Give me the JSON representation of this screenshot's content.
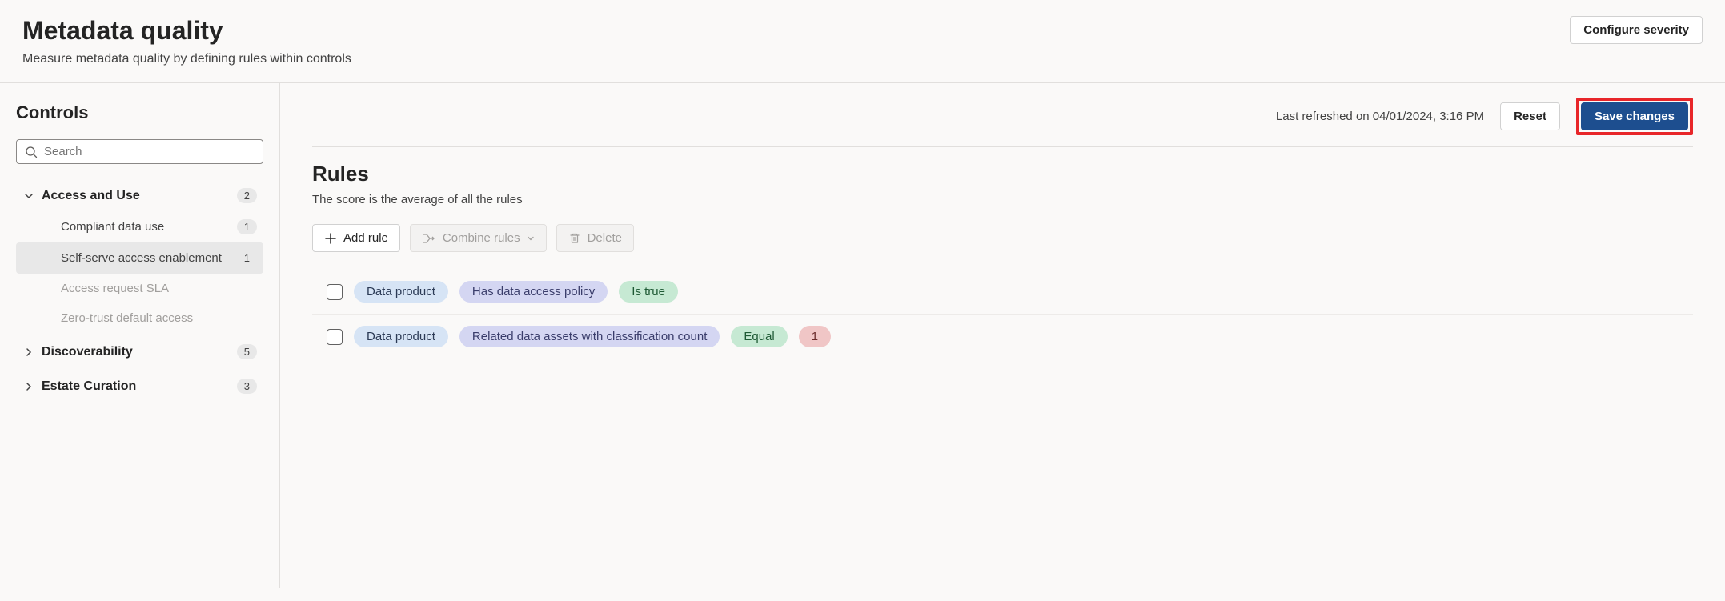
{
  "header": {
    "title": "Metadata quality",
    "subtitle": "Measure metadata quality by defining rules within controls",
    "configure_severity": "Configure severity"
  },
  "sidebar": {
    "title": "Controls",
    "search_placeholder": "Search",
    "groups": [
      {
        "label": "Access and Use",
        "count": "2",
        "expanded": true,
        "items": [
          {
            "label": "Compliant data use",
            "count": "1",
            "selected": false,
            "disabled": false
          },
          {
            "label": "Self-serve access enablement",
            "count": "1",
            "selected": true,
            "disabled": false
          },
          {
            "label": "Access request SLA",
            "count": "",
            "selected": false,
            "disabled": true
          },
          {
            "label": "Zero-trust default access",
            "count": "",
            "selected": false,
            "disabled": true
          }
        ]
      },
      {
        "label": "Discoverability",
        "count": "5",
        "expanded": false,
        "items": []
      },
      {
        "label": "Estate Curation",
        "count": "3",
        "expanded": false,
        "items": []
      }
    ]
  },
  "content": {
    "last_refreshed": "Last refreshed on 04/01/2024, 3:16 PM",
    "reset": "Reset",
    "save": "Save changes",
    "rules_title": "Rules",
    "rules_subtitle": "The score is the average of all the rules",
    "toolbar": {
      "add_rule": "Add rule",
      "combine_rules": "Combine rules",
      "delete": "Delete"
    },
    "rules": [
      {
        "subject": "Data product",
        "predicate": "Has data access policy",
        "operator": "Is true",
        "value": ""
      },
      {
        "subject": "Data product",
        "predicate": "Related data assets with classification count",
        "operator": "Equal",
        "value": "1"
      }
    ]
  }
}
